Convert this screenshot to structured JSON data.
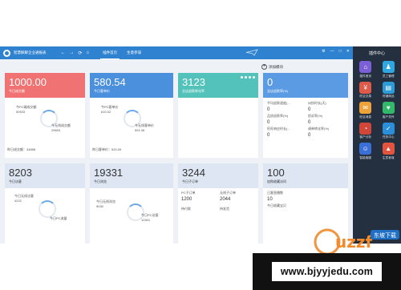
{
  "titlebar": {
    "app_title": "智慧解解企业通报表",
    "tabs": [
      {
        "label": "插件首页",
        "active": true
      },
      {
        "label": "生意参谋",
        "active": false
      }
    ],
    "nav": {
      "back": "←",
      "forward": "→",
      "refresh": "⟳",
      "home": "⌂"
    },
    "window_controls": {
      "settings": "⚙",
      "minimize": "—",
      "maximize": "□",
      "close": "✕"
    }
  },
  "main": {
    "add_widget_label": "添加模块"
  },
  "cards_top": [
    {
      "value": "1000.00",
      "label": "今日成交额",
      "ring_pct": 0.35,
      "stats": [
        {
          "label": "今PC端成交额",
          "value": "50533"
        },
        {
          "label": "今无线成交额",
          "value": "29693"
        }
      ],
      "footer": "昨日成交额：34858"
    },
    {
      "value": "580.54",
      "label": "今日客单价",
      "ring_pct": 0.35,
      "stats": [
        {
          "label": "今PC客单价",
          "value": "610.02"
        },
        {
          "label": "今无线客单价",
          "value": "591.06"
        }
      ],
      "footer": "昨日客单价：520.09"
    },
    {
      "value": "3123",
      "label": "全店退款转化率"
    },
    {
      "value": "0",
      "label": "全店退款率(%)",
      "grid": [
        {
          "label": "平均退款速度(...",
          "value": "0"
        },
        {
          "label": "纠纷时长(天)",
          "value": "0"
        },
        {
          "label": "品质退款率(%)",
          "value": "0"
        },
        {
          "label": "投诉率(%)",
          "value": "0"
        },
        {
          "label": "旺旺响应时长(...",
          "value": "0"
        },
        {
          "label": "调单转化率(%)",
          "value": "0"
        }
      ]
    }
  ],
  "cards_bottom": [
    {
      "value": "8203",
      "label": "今日访客",
      "stats": [
        {
          "label": "今日无线访客",
          "value": "4222"
        },
        {
          "label": "今日PC流量",
          "value": ""
        }
      ]
    },
    {
      "value": "19331",
      "label": "今日浏览",
      "stats": [
        {
          "label": "今日无线浏览",
          "value": "9030"
        },
        {
          "label": "今日PC访客",
          "value": "10301"
        }
      ]
    },
    {
      "value": "3244",
      "label": "今日子订单",
      "grid": [
        {
          "label": "PC子订单",
          "value": "1200"
        },
        {
          "label": "无线子订单",
          "value": "2044"
        },
        {
          "label": "待付款",
          "value": ""
        },
        {
          "label": "待发货",
          "value": ""
        }
      ]
    },
    {
      "value": "100",
      "label": "加购收藏访问",
      "grid": [
        {
          "label": "已客直播数",
          "value": "10"
        },
        {
          "label": "今日收藏宝贝",
          "value": ""
        },
        {
          "label": "今收藏宝贝",
          "value": ""
        },
        {
          "label": "今被收藏宝贝",
          "value": ""
        }
      ]
    }
  ],
  "sidebar": {
    "title": "插件中心",
    "items": [
      {
        "label": "插件首页",
        "color": "#7a5fd6",
        "icon": "home-icon",
        "glyph": "⌂"
      },
      {
        "label": "员工管理",
        "color": "#2fa7e0",
        "icon": "people-icon",
        "glyph": "♟"
      },
      {
        "label": "旺店交易",
        "color": "#e05a4a",
        "icon": "trade-icon",
        "glyph": "¥"
      },
      {
        "label": "旺铺商品",
        "color": "#2c9bd6",
        "icon": "goods-icon",
        "glyph": "▤"
      },
      {
        "label": "旺店消息",
        "color": "#f0a23a",
        "icon": "message-icon",
        "glyph": "✉"
      },
      {
        "label": "客户关怀",
        "color": "#33b86a",
        "icon": "care-icon",
        "glyph": "♥"
      },
      {
        "label": "客户分析",
        "color": "#d0473a",
        "icon": "analysis-icon",
        "glyph": "◔"
      },
      {
        "label": "任务中心",
        "color": "#2a8fd8",
        "icon": "task-icon",
        "glyph": "✓"
      },
      {
        "label": "智能客服",
        "color": "#3a6fd8",
        "icon": "service-icon",
        "glyph": "☺"
      },
      {
        "label": "生意参谋",
        "color": "#e2543e",
        "icon": "business-icon",
        "glyph": "▲"
      }
    ]
  },
  "watermark": {
    "brand": "uzzf",
    "brand_tag": "东坡下载",
    "site_url": "www.bjyyjedu.com"
  }
}
